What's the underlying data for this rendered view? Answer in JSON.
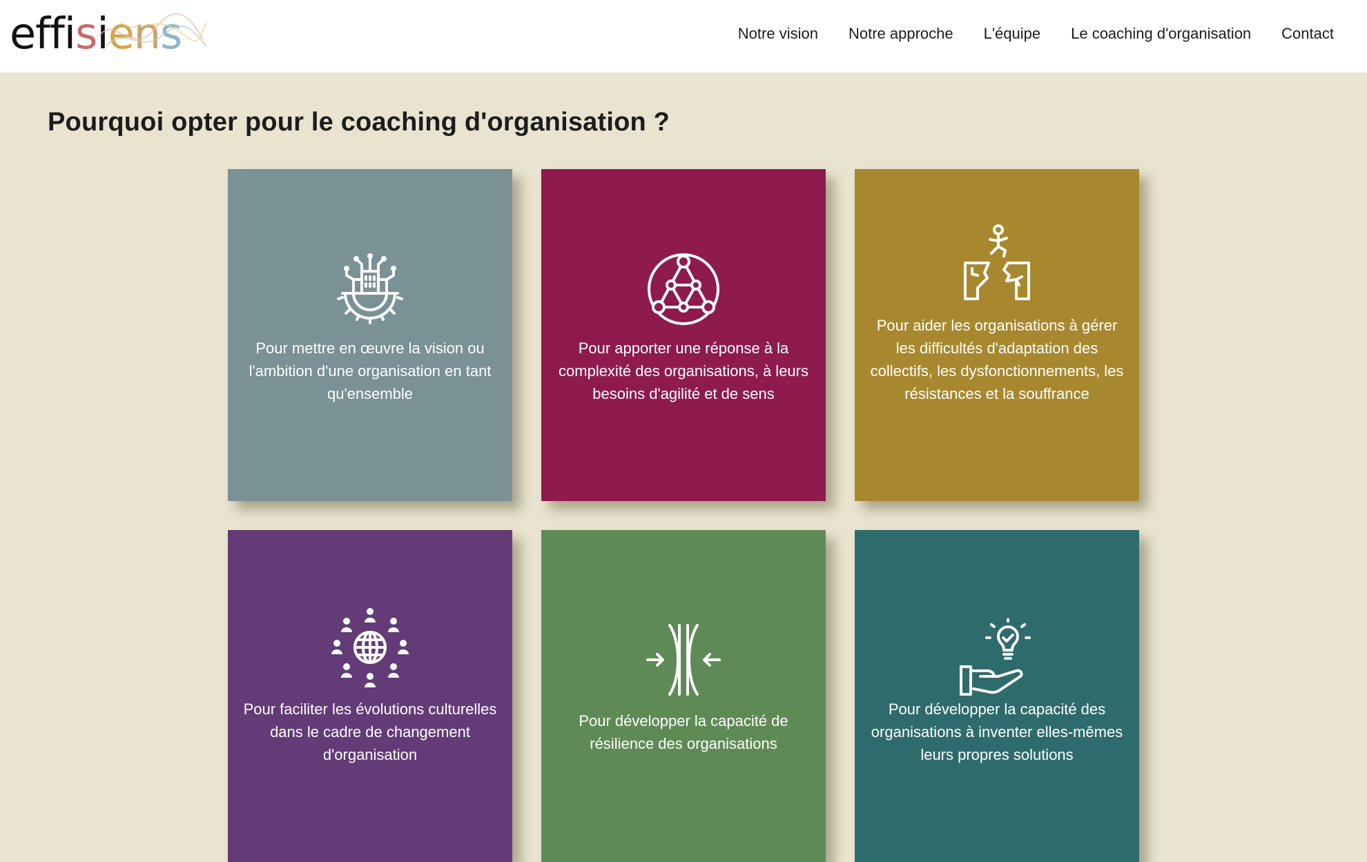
{
  "header": {
    "logo_text": "effisiens",
    "nav": [
      {
        "label": "Notre vision"
      },
      {
        "label": "Notre approche"
      },
      {
        "label": "L'équipe"
      },
      {
        "label": "Le coaching d'organisation"
      },
      {
        "label": "Contact"
      }
    ]
  },
  "main": {
    "title": "Pourquoi opter pour le coaching d'organisation ?",
    "cards": [
      {
        "icon": "gear-city-icon",
        "color": "#7a9196",
        "text": "Pour mettre en œuvre la vision ou l'ambition d'une organisation en tant qu'ensemble"
      },
      {
        "icon": "network-sphere-icon",
        "color": "#8e1a4e",
        "text": "Pour apporter une réponse à la complexité des organisations, à leurs besoins d'agilité et de sens"
      },
      {
        "icon": "gap-jump-icon",
        "color": "#a8882e",
        "text": "Pour aider les organisations à gérer les difficultés d'adaptation des collectifs, les dysfonctionnements, les résistances et la souffrance"
      },
      {
        "icon": "globe-people-icon",
        "color": "#633b77",
        "text": "Pour faciliter les évolutions culturelles dans le cadre de changement d'organisation"
      },
      {
        "icon": "resilience-arrows-icon",
        "color": "#5e8b55",
        "text": "Pour développer la capacité de résilience des organisations"
      },
      {
        "icon": "hand-lightbulb-icon",
        "color": "#2e6b6c",
        "text": "Pour développer la capacité des organisations à inventer elles-mêmes leurs propres solutions"
      }
    ]
  }
}
